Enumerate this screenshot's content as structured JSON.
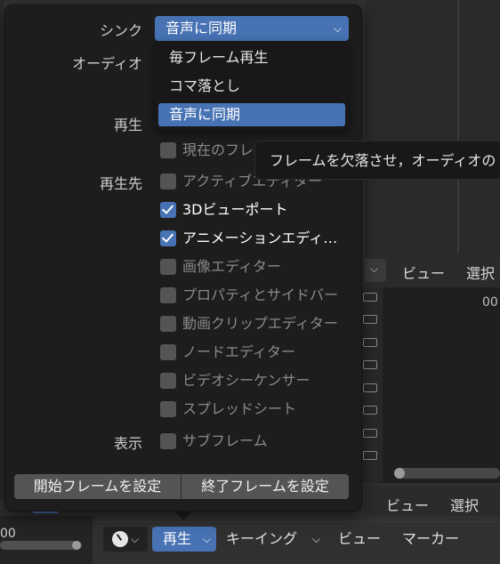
{
  "background": {
    "header_top": {
      "view": "ビュー",
      "select": "選択"
    },
    "graph_number": "00",
    "header_bottom": {
      "view": "ビュー",
      "select": "選択"
    },
    "left_bottom_text": "00"
  },
  "timeline_header": {
    "play_label": "再生",
    "keying_label": "キーイング",
    "view_label": "ビュー",
    "marker_label": "マーカー"
  },
  "popover": {
    "sync_label": "シンク",
    "audio_label": "オーディオ",
    "playback_label": "再生",
    "play_in_label": "再生先",
    "display_label": "表示",
    "sync_selected": "音声に同期",
    "sync_options": [
      "毎フレーム再生",
      "コマ落とし",
      "音声に同期"
    ],
    "tooltip": "フレームを欠落させ，オーディオの",
    "checkboxes": [
      {
        "label": "現在のフレ",
        "checked": false
      },
      {
        "label": "アクティブエディター",
        "checked": false
      },
      {
        "label": "3Dビューポート",
        "checked": true
      },
      {
        "label": "アニメーションエディ…",
        "checked": true
      },
      {
        "label": "画像エディター",
        "checked": false
      },
      {
        "label": "プロパティとサイドバー",
        "checked": false
      },
      {
        "label": "動画クリップエディター",
        "checked": false
      },
      {
        "label": "ノードエディター",
        "checked": false
      },
      {
        "label": "ビデオシーケンサー",
        "checked": false
      },
      {
        "label": "スプレッドシート",
        "checked": false
      }
    ],
    "subframe_label": "サブフレーム",
    "set_start_button": "開始フレームを設定",
    "set_end_button": "終了フレームを設定"
  }
}
